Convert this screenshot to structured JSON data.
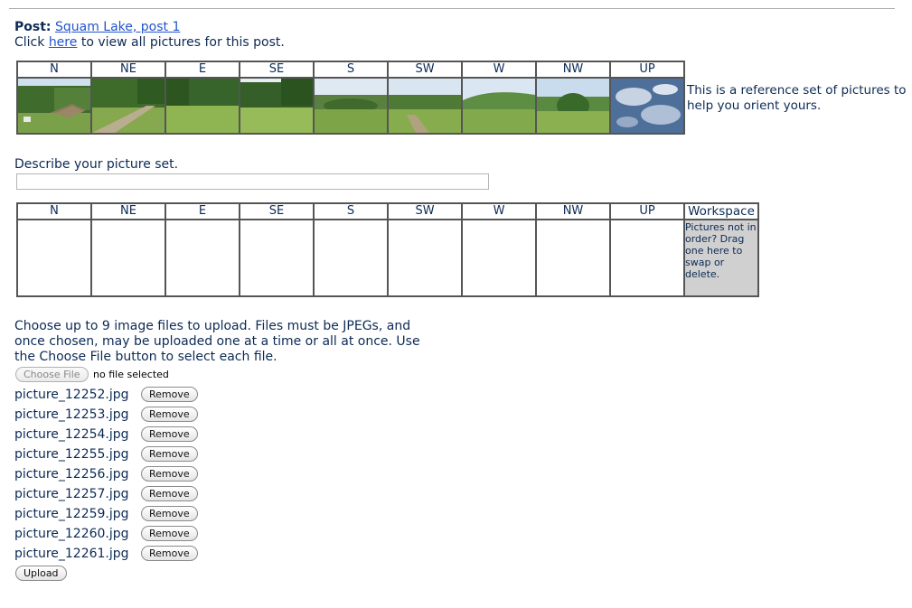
{
  "post": {
    "label": "Post:",
    "link": "Squam Lake, post 1"
  },
  "view_line": {
    "prefix": "Click ",
    "link": "here",
    "suffix": " to view all pictures for this post."
  },
  "directions": [
    "N",
    "NE",
    "E",
    "SE",
    "S",
    "SW",
    "W",
    "NW",
    "UP"
  ],
  "reference_note": "This is a reference set of pictures to help you orient yours.",
  "describe": {
    "label": "Describe your picture set.",
    "value": ""
  },
  "workspace": {
    "header": "Workspace",
    "text": "Pictures not in order? Drag one here to swap or delete."
  },
  "upload_instructions": "Choose up to 9 image files to upload. Files must be JPEGs, and once chosen, may be uploaded one at a time or all at once. Use the Choose File button to select each file.",
  "choose_file": {
    "button": "Choose File",
    "status": "no file selected"
  },
  "files": [
    "picture_12252.jpg",
    "picture_12253.jpg",
    "picture_12254.jpg",
    "picture_12255.jpg",
    "picture_12256.jpg",
    "picture_12257.jpg",
    "picture_12259.jpg",
    "picture_12260.jpg",
    "picture_12261.jpg"
  ],
  "remove_label": "Remove",
  "upload_label": "Upload",
  "colors": {
    "text": "#0c2a55",
    "link": "#2255cc",
    "workspace_bg": "#d0d0d0",
    "border": "#555555"
  }
}
